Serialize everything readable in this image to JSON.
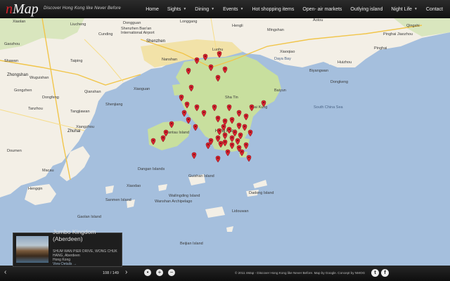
{
  "header": {
    "logo_n": "n",
    "logo_map": "Map",
    "tagline": "Discover Hong Kong like Never Before",
    "nav": [
      {
        "label": "Home",
        "dropdown": false
      },
      {
        "label": "Sights",
        "dropdown": true
      },
      {
        "label": "Dining",
        "dropdown": true
      },
      {
        "label": "Events",
        "dropdown": true
      },
      {
        "label": "Hot shopping items",
        "dropdown": false
      },
      {
        "label": "Open- air markets",
        "dropdown": false
      },
      {
        "label": "Outlying island",
        "dropdown": false
      },
      {
        "label": "Night Life",
        "dropdown": true
      },
      {
        "label": "Contact",
        "dropdown": false
      }
    ]
  },
  "map_labels": {
    "dongguan": "Dongguan",
    "shenzhen_airport": "Shenzhen Bao'an International Airport",
    "longgang": "Longgang",
    "shenzhen": "Shenzhen",
    "nanshan": "Nanshan",
    "luohu": "Luohu",
    "shatin": "Sha Tin",
    "sai_kung": "Sai Kung",
    "daya_bay": "Daya Bay",
    "huizhou": "Huizhou",
    "zhongshan": "Zhongshan",
    "gongzhen": "Gongzhen",
    "wuguishan": "Wuguishan",
    "tanzhou": "Tanzhou",
    "qianshan": "Qianshan",
    "tangjiawan": "Tangjiawan",
    "xiangzhou": "Xiangzhou",
    "zhuhai": "Zhuhai",
    "doumen": "Doumen",
    "macau": "Macau",
    "hengqin": "Hengqin",
    "lantau": "Lantau Island",
    "hong_kong": "Hong Kong",
    "south_china_sea": "South China Sea",
    "dangan": "Dangan Islands",
    "wanshan": "Wanshan Archipelago",
    "guishan": "Guishan Island",
    "lidouwan": "Lidouwan",
    "wailingding": "Wailingding Island",
    "dadong": "Dadong Island",
    "baiyun": "Baiyun",
    "xiaodao": "Xiaodao",
    "pinghai": "Pinghai",
    "aotou": "Aotou",
    "xiaoqiao": "Xiaoqiao",
    "biyangwan": "Biyangwan",
    "pinghai2": "Pinghai Jiaozhou",
    "sanmen": "Sanmen Island",
    "gaolan": "Gaolan Island",
    "beijian": "Beijian Island",
    "liucheng": "Liucheng",
    "xiaolan": "Xiaolan",
    "xiaoguan": "Xiaoguan",
    "mingshan": "Mingshan",
    "cunding": "Cunding",
    "dongkeng": "Dongkeng",
    "shenjiang": "Shenjiang",
    "dongfeng": "Dongfeng",
    "qingshi": "Qingshi",
    "taiping": "Taiping",
    "shawan": "Shawan",
    "gaozhou": "Gaozhou",
    "hengli": "Hengli"
  },
  "info_panel": {
    "title": "Jumbo Kingdom (Aberdeen)",
    "address": "SHUM WAN PIER DRIVE, WONG CHUK HANG, Aberdeen",
    "region": "Hong Kong",
    "link": "View Details →",
    "counter": "108 / 149"
  },
  "footer": {
    "copyright": "© 2011 nMap - Discover Hong Kong like Never Before. Map by Google. Concept by NMOG"
  },
  "colors": {
    "sea": "#a5bfdd",
    "land": "#f3efe6",
    "green_land": "#c8df9e",
    "urban": "#f2d98f",
    "marker": "#d8232f",
    "logo_accent": "#d6202a"
  }
}
